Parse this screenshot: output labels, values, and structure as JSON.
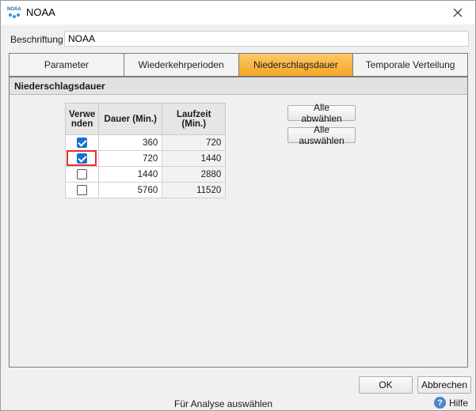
{
  "window": {
    "title": "NOAA",
    "app_icon": "noaa-logo-icon",
    "close_icon": "close-icon"
  },
  "caption": {
    "label": "Beschriftung",
    "value": "NOAA"
  },
  "tabs": [
    {
      "label": "Parameter",
      "active": false
    },
    {
      "label": "Wiederkehrperioden",
      "active": false
    },
    {
      "label": "Niederschlagsdauer",
      "active": true
    },
    {
      "label": "Temporale Verteilung",
      "active": false
    }
  ],
  "section": {
    "title": "Niederschlagsdauer"
  },
  "grid": {
    "columns": [
      "Verwenden",
      "Dauer (Min.)",
      "Laufzeit (Min.)"
    ],
    "rows": [
      {
        "use": true,
        "duration": "360",
        "runtime": "720"
      },
      {
        "use": true,
        "duration": "720",
        "runtime": "1440"
      },
      {
        "use": false,
        "duration": "1440",
        "runtime": "2880"
      },
      {
        "use": false,
        "duration": "5760",
        "runtime": "11520"
      }
    ]
  },
  "buttons": {
    "deselect_all": "Alle abwählen",
    "select_all": "Alle auswählen",
    "ok": "OK",
    "cancel": "Abbrechen"
  },
  "status": {
    "text": "Für Analyse auswählen"
  },
  "help": {
    "label": "Hilfe",
    "icon": "help-icon"
  },
  "colors": {
    "active_tab": "#f5a623",
    "checkbox_checked": "#1a6fd4",
    "selection_outline": "#e03030"
  }
}
